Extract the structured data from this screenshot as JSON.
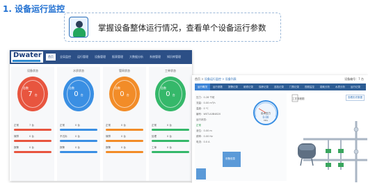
{
  "slide": {
    "title": "1. 设备运行监控",
    "banner_text": "掌握设备整体运行情况，查看单个设备运行参数"
  },
  "dashboard": {
    "logo": "Dwater",
    "menu": [
      "首页",
      "全局监控",
      "运行管理",
      "设备管理",
      "报表管理",
      "大数据分析",
      "系统管理",
      "知识库管理"
    ],
    "active_menu_index": 0,
    "cards": [
      {
        "title": "设备状态",
        "circle_label": "总数",
        "value": "7",
        "unit": "台",
        "color": "#e8553f",
        "rows": [
          [
            "正常",
            "7 台"
          ],
          [
            "故障",
            "0 台"
          ],
          [
            "报警",
            "0 台"
          ]
        ]
      },
      {
        "title": "水质状态",
        "circle_label": "总数",
        "value": "0",
        "unit": "台",
        "color": "#3a8fe3",
        "rows": [
          [
            "正常",
            "0 台"
          ],
          [
            "不达标",
            "0 台"
          ],
          [
            "报警",
            "0 台"
          ]
        ]
      },
      {
        "title": "管网状态",
        "circle_label": "总数",
        "value": "0",
        "unit": "台",
        "color": "#f28c28",
        "rows": [
          [
            "正常",
            "0 台"
          ],
          [
            "故障",
            "0 台"
          ],
          [
            "报警",
            "0 台"
          ]
        ]
      },
      {
        "title": "工单状态",
        "circle_label": "总数",
        "value": "0",
        "unit": "台",
        "color": "#35b86a",
        "rows": [
          [
            "正常",
            "0 台"
          ],
          [
            "处理",
            "0 台"
          ],
          [
            "工单",
            "0 台"
          ]
        ]
      }
    ]
  },
  "detail": {
    "crumbs_prefix": "首页 > ",
    "crumbs_link": "设备运行监控 > 设备列表",
    "top_right": "设备编号：7 台",
    "tabs": [
      "运行概况",
      "运行参数",
      "报警记录",
      "维修记录",
      "保养记录",
      "巡检记录",
      "门禁记录",
      "视频监控",
      "能耗分析",
      "水质分析",
      "运行记录"
    ],
    "active_tab_index": 0,
    "params": [
      "压力：0.28 千帕",
      "流量：0.00 m³/h",
      "温度：0 ℃",
      "编号：WST-A0B4820",
      "运行状态：",
      "正常",
      "液位：0.00 m",
      "频率：0.00 Hz",
      "电流：0.0 A"
    ],
    "gauge_label": "出水压力",
    "gauge_value": "0.00",
    "gauge_unit": "MPa",
    "sub_label": "设备信息",
    "diagram_title": "工艺流程图",
    "diagram_button": "查看历史数据"
  },
  "colors": {
    "accent": "#1f6fd1",
    "nav": "#2c4f86"
  }
}
